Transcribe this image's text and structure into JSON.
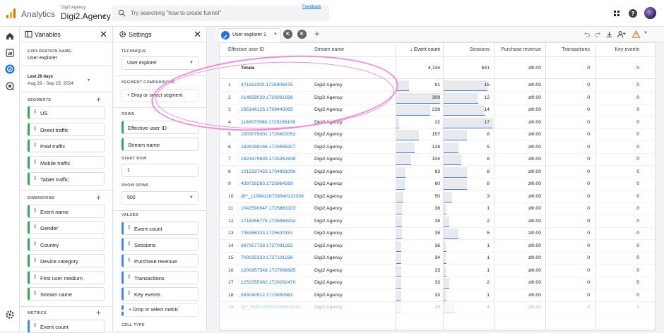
{
  "topbar": {
    "app_name": "Analytics",
    "account_label": "Digi2 Agency",
    "account_name": "Digi2.Agency",
    "search_placeholder": "Try searching \"how to create funnel\"",
    "feedback": "Feedback"
  },
  "variables": {
    "title": "Variables",
    "exploration_label": "EXPLORATION NAME:",
    "exploration_name": "User explorer",
    "date_label": "Last 28 days",
    "date_range": "Aug 29 - Sep 25, 2024",
    "segments_label": "SEGMENTS",
    "segments": [
      "US",
      "Direct traffic",
      "Paid traffic",
      "Mobile traffic",
      "Tablet traffic"
    ],
    "dimensions_label": "DIMENSIONS",
    "dimensions": [
      "Event name",
      "Gender",
      "Country",
      "Device category",
      "First user medium",
      "Stream name"
    ],
    "metrics_label": "METRICS",
    "metrics": [
      "Event count"
    ]
  },
  "settings": {
    "title": "Settings",
    "technique_label": "TECHNIQUE",
    "technique": "User explorer",
    "segment_comparisons_label": "SEGMENT COMPARISONS",
    "segment_drop": "Drop or select segment",
    "rows_label": "ROWS",
    "rows": [
      "Effective user ID",
      "Stream name"
    ],
    "start_row_label": "START ROW",
    "start_row": "1",
    "show_rows_label": "SHOW ROWS",
    "show_rows": "500",
    "values_label": "VALUES",
    "values": [
      "Event count",
      "Sessions",
      "Purchase revenue",
      "Transactions",
      "Key events"
    ],
    "metric_drop": "Drop or select metric",
    "cell_type_label": "CELL TYPE"
  },
  "tabs": {
    "active": "User explorer 1",
    "others": [
      "K",
      "K"
    ]
  },
  "table": {
    "headers": [
      "Effective user ID",
      "Stream name",
      "↓ Event count",
      "Sessions",
      "Purchase revenue",
      "Transactions",
      "Key events"
    ],
    "totals": {
      "label": "Totals",
      "event_count": "4,744",
      "sessions": "641",
      "revenue": "zł0.00",
      "transactions": "0",
      "key_events": "0"
    },
    "rows": [
      {
        "n": "1",
        "id": "471163100.1725906975",
        "stream": "Digi2 Agency",
        "events": "91",
        "sessions": "15",
        "revenue": "zł0.00",
        "trans": "0",
        "key": "0"
      },
      {
        "n": "2",
        "id": "214658029.1726061699",
        "stream": "Digi2 Agency",
        "events": "309",
        "sessions": "12",
        "revenue": "zł0.00",
        "trans": "0",
        "key": "0"
      },
      {
        "n": "3",
        "id": "235146125.1708443065",
        "stream": "Digi2 Agency",
        "events": "238",
        "sessions": "14",
        "revenue": "zł0.00",
        "trans": "0",
        "key": "0"
      },
      {
        "n": "4",
        "id": "1166073966.1725286106",
        "stream": "Digi2 Agency",
        "events": "22",
        "sessions": "17",
        "revenue": "zł0.00",
        "trans": "0",
        "key": "0"
      },
      {
        "n": "5",
        "id": "1003075001.1726602052",
        "stream": "Digi2 Agency",
        "events": "157",
        "sessions": "8",
        "revenue": "zł0.00",
        "trans": "0",
        "key": "0"
      },
      {
        "n": "6",
        "id": "1826189156.1725955207",
        "stream": "Digi2 Agency",
        "events": "128",
        "sessions": "5",
        "revenue": "zł0.00",
        "trans": "0",
        "key": "0"
      },
      {
        "n": "7",
        "id": "1524479839.1725352638",
        "stream": "Digi2 Agency",
        "events": "104",
        "sessions": "6",
        "revenue": "zł0.00",
        "trans": "0",
        "key": "0"
      },
      {
        "n": "8",
        "id": "1015337453.1704981096",
        "stream": "Digi2 Agency",
        "events": "63",
        "sessions": "8",
        "revenue": "zł0.00",
        "trans": "0",
        "key": "0"
      },
      {
        "n": "9",
        "id": "439728263.1725864269",
        "stream": "Digi2 Agency",
        "events": "60",
        "sessions": "8",
        "revenue": "zł0.00",
        "trans": "0",
        "key": "0"
      },
      {
        "n": "10",
        "id": "@^_11084128728640122308",
        "stream": "Digi2 Agency",
        "events": "50",
        "sessions": "3",
        "revenue": "zł0.00",
        "trans": "0",
        "key": "0"
      },
      {
        "n": "11",
        "id": "1042590947.1725863103",
        "stream": "Digi2 Agency",
        "events": "38",
        "sessions": "1",
        "revenue": "zł0.00",
        "trans": "0",
        "key": "0"
      },
      {
        "n": "12",
        "id": "1716356775.1726864934",
        "stream": "Digi2 Agency",
        "events": "38",
        "sessions": "2",
        "revenue": "zł0.00",
        "trans": "0",
        "key": "0"
      },
      {
        "n": "13",
        "id": "735356333.1725620151",
        "stream": "Digi2 Agency",
        "events": "38",
        "sessions": "5",
        "revenue": "zł0.00",
        "trans": "0",
        "key": "0"
      },
      {
        "n": "14",
        "id": "697357728.1727091322",
        "stream": "Digi2 Agency",
        "events": "36",
        "sessions": "1",
        "revenue": "zł0.00",
        "trans": "0",
        "key": "0"
      },
      {
        "n": "15",
        "id": "703025323.1727101236",
        "stream": "Digi2 Agency",
        "events": "34",
        "sessions": "1",
        "revenue": "zł0.00",
        "trans": "0",
        "key": "0"
      },
      {
        "n": "16",
        "id": "1200957548.1727096885",
        "stream": "Digi2 Agency",
        "events": "33",
        "sessions": "1",
        "revenue": "zł0.00",
        "trans": "0",
        "key": "0"
      },
      {
        "n": "17",
        "id": "1253355082.1720292470",
        "stream": "Digi2 Agency",
        "events": "33",
        "sessions": "2",
        "revenue": "zł0.00",
        "trans": "0",
        "key": "0"
      },
      {
        "n": "18",
        "id": "833040512.1713850961",
        "stream": "Digi2 Agency",
        "events": "33",
        "sessions": "1",
        "revenue": "zł0.00",
        "trans": "0",
        "key": "0"
      },
      {
        "n": "19",
        "id": "@^_4560119931586916453",
        "stream": "Digi2 Agency",
        "events": "29",
        "sessions": "4",
        "revenue": "zł0.00",
        "trans": "0",
        "key": "0"
      }
    ]
  },
  "colors": {
    "accent": "#1a73e8",
    "segment": "#34a853",
    "metric": "#4285f4",
    "annotation": "#f28ad4"
  }
}
